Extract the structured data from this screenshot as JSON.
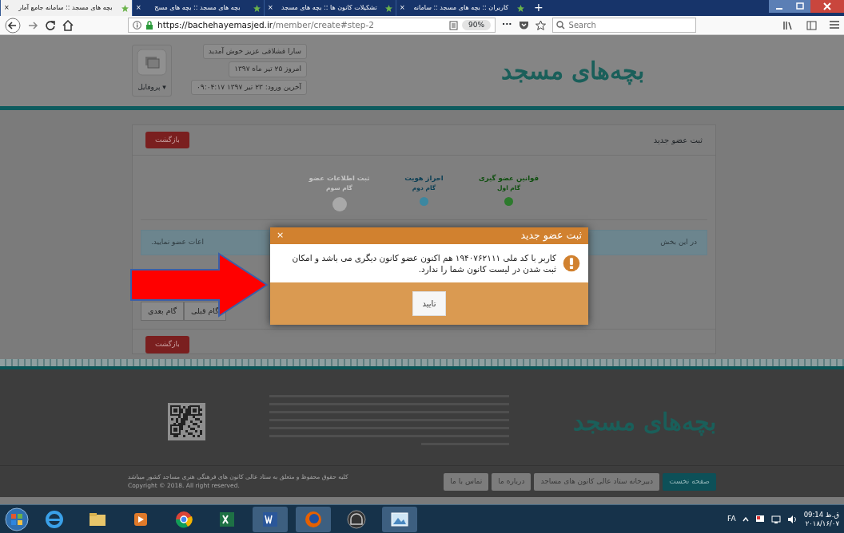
{
  "browser": {
    "tabs": [
      {
        "title": "کاربران :: بچه های مسجد :: سامانه",
        "close": "×",
        "selected": false
      },
      {
        "title": "تشکیلات کانون ها :: بچه های مسجد",
        "close": "×",
        "selected": false
      },
      {
        "title": "بچه های مسجد :: بچه های مسج",
        "close": "×",
        "selected": false
      },
      {
        "title": "بچه های مسجد :: سامانه جامع آمار",
        "close": "×",
        "selected": true
      }
    ],
    "new_tab": "+",
    "url_host": "https://bachehayemasjed.ir",
    "url_path": "/member/create#step-2",
    "zoom": "90%",
    "more": "···",
    "search": {
      "placeholder": "Search"
    }
  },
  "header": {
    "logo": "بچه‌های مسجد",
    "greeting": "سارا قشلاقی عزیز خوش آمدید",
    "today": "امروز ۲۵ تیر ماه ۱۳۹۷",
    "last_login": "آخرین ورود: ۲۳ تیر ۱۳۹۷ ۰۹:۰۴:۱۷",
    "profile": "پروفایل ▾"
  },
  "card": {
    "title": "ثبت عضو جدید",
    "back_top": "بازگشت",
    "back_bottom": "بازگشت",
    "steps": [
      {
        "title": "قوانین عضو گیری",
        "subtitle": "گام اول",
        "done": true,
        "current": false
      },
      {
        "title": "احراز هویت",
        "subtitle": "گام دوم",
        "done": false,
        "current": true
      },
      {
        "title": "ثبت اطلاعات عضو",
        "subtitle": "گام سوم",
        "done": false,
        "current": false
      }
    ],
    "alert_start": "در این بخش",
    "alert_end": "اعات عضو نمایید.",
    "prev": "گام قبلی",
    "next": "گام بعدی"
  },
  "modal": {
    "title": "ثبت عضو جدید",
    "close": "×",
    "message": "کاربر با کد ملی ۱۹۴۰۷۶۲۱۱۱ هم اکنون عضو کانون دیگری می باشد و امکان ثبت شدن در لیست کانون شما را ندارد.",
    "confirm": "تایید"
  },
  "footer": {
    "logo": "بچه‌های مسجد",
    "nav": [
      {
        "label": "صفحه نخست",
        "selected": true
      },
      {
        "label": "دبیرخانه ستاد عالی کانون های مساجد",
        "selected": false
      },
      {
        "label": "درباره ما",
        "selected": false
      },
      {
        "label": "تماس با ما",
        "selected": false
      }
    ],
    "rights": "کلیه حقوق محفوظ و متعلق به ستاد عالی کانون های فرهنگی هنری مساجد کشور میباشد",
    "copyright": "Copyright © 2018. All right reserved."
  },
  "taskbar": {
    "language": "FA",
    "time": "ق.ظ 09:14",
    "date": "۲۰۱۸/۱۶/۰۷"
  }
}
